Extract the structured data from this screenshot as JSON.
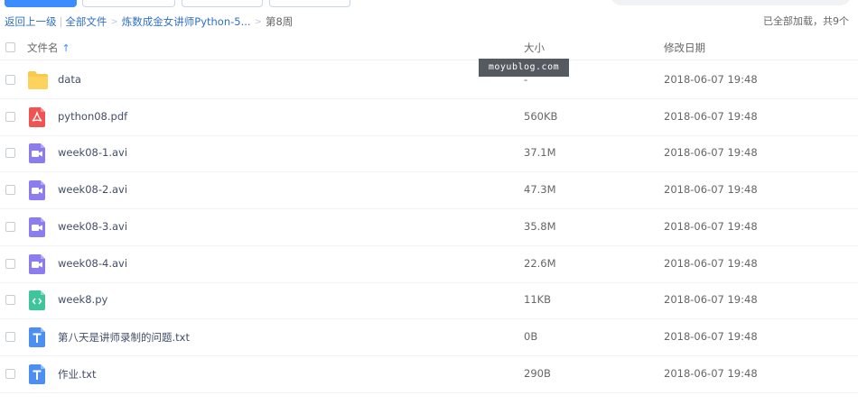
{
  "breadcrumb": {
    "back": "返回上一级",
    "all_files": "全部文件",
    "parent": "炼数成金女讲师Python-5...",
    "current": "第8周"
  },
  "status_text": "已全部加载，共9个",
  "header": {
    "name": "文件名",
    "size": "大小",
    "date": "修改日期"
  },
  "watermark": "moyublog.com",
  "files": [
    {
      "name": "data",
      "size": "-",
      "date": "2018-06-07 19:48",
      "icon": "folder-icon"
    },
    {
      "name": "python08.pdf",
      "size": "560KB",
      "date": "2018-06-07 19:48",
      "icon": "pdf-file-icon"
    },
    {
      "name": "week08-1.avi",
      "size": "37.1M",
      "date": "2018-06-07 19:48",
      "icon": "video-file-icon"
    },
    {
      "name": "week08-2.avi",
      "size": "47.3M",
      "date": "2018-06-07 19:48",
      "icon": "video-file-icon"
    },
    {
      "name": "week08-3.avi",
      "size": "35.8M",
      "date": "2018-06-07 19:48",
      "icon": "video-file-icon"
    },
    {
      "name": "week08-4.avi",
      "size": "22.6M",
      "date": "2018-06-07 19:48",
      "icon": "video-file-icon"
    },
    {
      "name": "week8.py",
      "size": "11KB",
      "date": "2018-06-07 19:48",
      "icon": "code-file-icon"
    },
    {
      "name": "第八天是讲师录制的问题.txt",
      "size": "0B",
      "date": "2018-06-07 19:48",
      "icon": "text-file-icon"
    },
    {
      "name": "作业.txt",
      "size": "290B",
      "date": "2018-06-07 19:48",
      "icon": "text-file-icon"
    }
  ]
}
